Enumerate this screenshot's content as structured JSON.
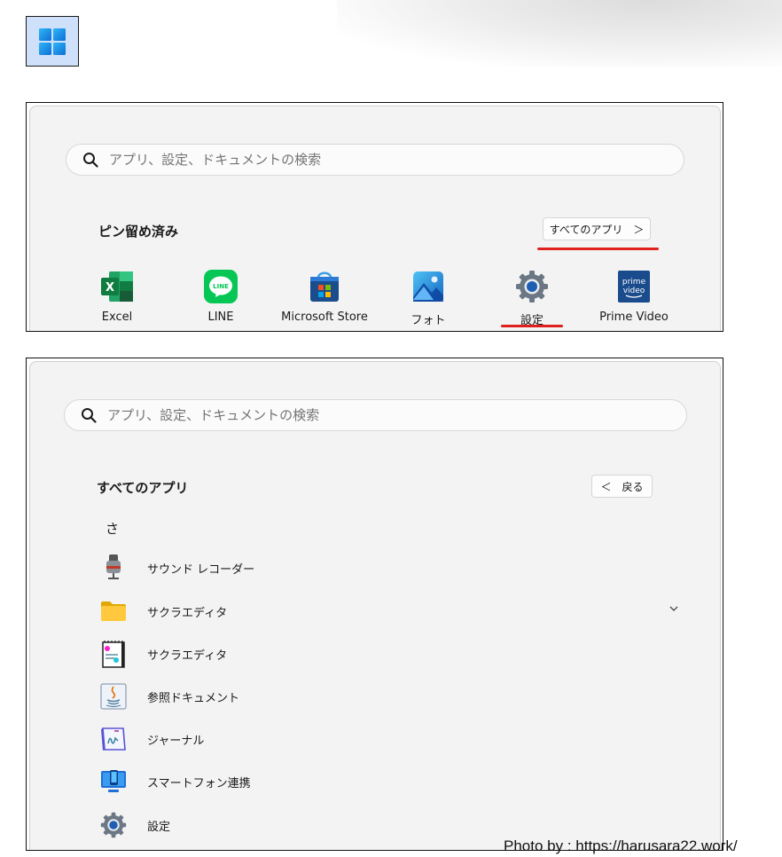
{
  "start_button": {
    "icon": "windows-logo-icon"
  },
  "panel1": {
    "search": {
      "placeholder": "アプリ、設定、ドキュメントの検索"
    },
    "title": "ピン留め済み",
    "all_apps_button": "すべてのアプリ　＞",
    "apps": [
      {
        "label": "Excel",
        "icon": "excel-icon"
      },
      {
        "label": "LINE",
        "icon": "line-icon"
      },
      {
        "label": "Microsoft Store",
        "icon": "microsoft-store-icon"
      },
      {
        "label": "フォト",
        "icon": "photos-icon"
      },
      {
        "label": "設定",
        "icon": "settings-gear-icon"
      },
      {
        "label": "Prime Video",
        "icon": "prime-video-icon"
      }
    ],
    "highlight_color": "#e0201c"
  },
  "panel2": {
    "search": {
      "placeholder": "アプリ、設定、ドキュメントの検索"
    },
    "title": "すべてのアプリ",
    "back_button": "＜　戻る",
    "group_letter": "さ",
    "apps": [
      {
        "label": "サウンド レコーダー",
        "icon": "microphone-icon"
      },
      {
        "label": "サクラエディタ",
        "icon": "folder-icon",
        "expandable": true
      },
      {
        "label": "サクラエディタ",
        "icon": "notepad-icon"
      },
      {
        "label": "参照ドキュメント",
        "icon": "java-doc-icon"
      },
      {
        "label": "ジャーナル",
        "icon": "journal-icon"
      },
      {
        "label": "スマートフォン連携",
        "icon": "phone-link-icon"
      },
      {
        "label": "設定",
        "icon": "settings-gear-icon"
      }
    ]
  },
  "credit": "Photo by : https://harusara22.work/",
  "colors": {
    "start_bg": "#cfe0fb",
    "windows_blue": "#1a8ee8",
    "panel_bg": "#f3f3f3"
  }
}
